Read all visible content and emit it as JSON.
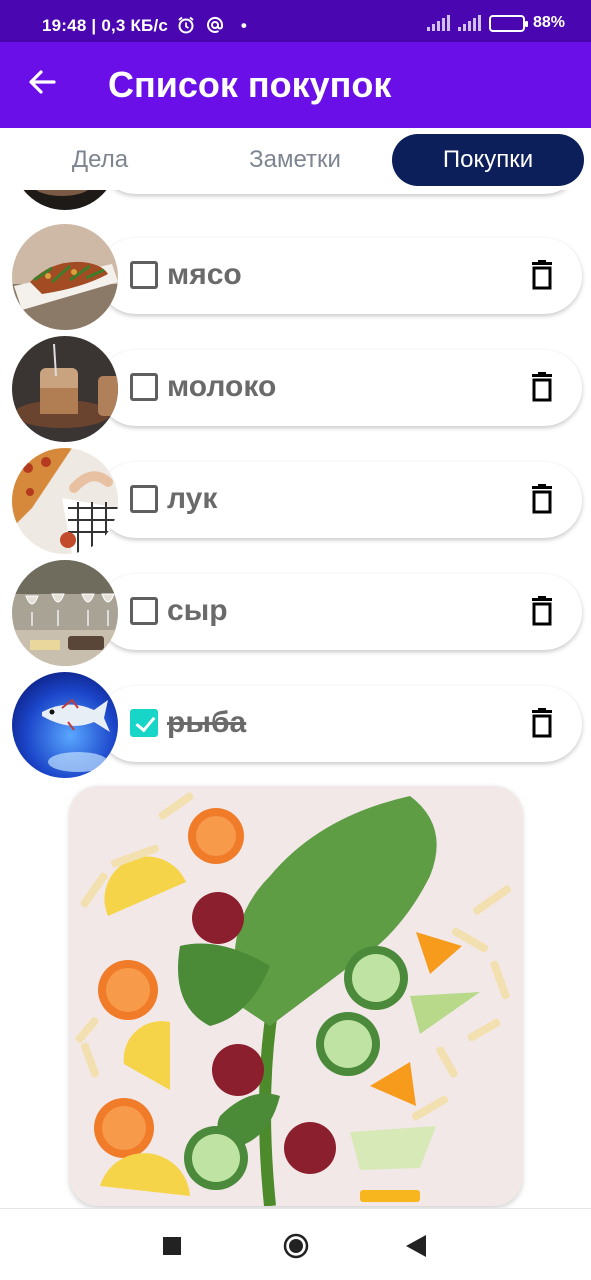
{
  "status_bar": {
    "time": "19:48",
    "speed": "0,3 КБ/с",
    "alarm_icon": "alarm-clock-icon",
    "at_icon": "at-sign-icon",
    "network": "H",
    "battery_percent": "88%",
    "battery_level": 0.88
  },
  "app_bar": {
    "title": "Список покупок",
    "back_icon": "arrow-left-icon"
  },
  "tabs": [
    {
      "label": "Дела",
      "selected": false
    },
    {
      "label": "Заметки",
      "selected": false
    },
    {
      "label": "Покупки",
      "selected": true
    }
  ],
  "items": [
    {
      "label": "мясо",
      "checked": false,
      "image": "meat-dish-photo"
    },
    {
      "label": "молоко",
      "checked": false,
      "image": "milk-jars-photo"
    },
    {
      "label": "лук",
      "checked": false,
      "image": "pizza-table-photo"
    },
    {
      "label": "сыр",
      "checked": false,
      "image": "wine-cheese-photo"
    },
    {
      "label": "рыба",
      "checked": true,
      "image": "blue-fish-photo"
    }
  ],
  "footer_image": "vegetables-kale-photo",
  "nav": [
    "square-recents-icon",
    "circle-home-icon",
    "triangle-back-icon"
  ],
  "colors": {
    "status_bar": "#4a06b0",
    "app_bar": "#6a0fe8",
    "tab_selected": "#0c1f5b",
    "checkbox_checked": "#18d6c7",
    "label_text": "#6a6a6a"
  }
}
